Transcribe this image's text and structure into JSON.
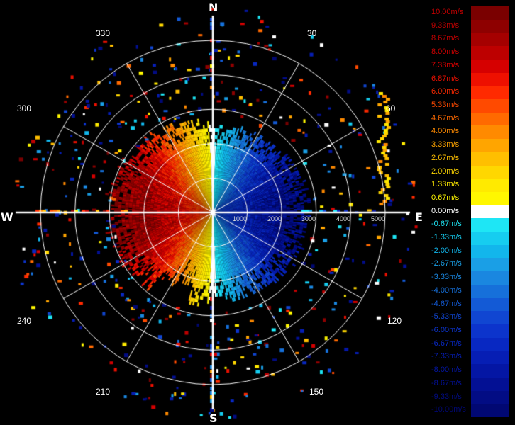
{
  "compass": {
    "north": "N",
    "south": "S",
    "east": "E",
    "west": "W"
  },
  "angle_labels": [
    "30",
    "60",
    "120",
    "150",
    "210",
    "240",
    "300",
    "330"
  ],
  "range_labels": [
    "1000",
    "2000",
    "3000",
    "4000",
    "5000"
  ],
  "legend": {
    "items": [
      {
        "label": "10.00m/s",
        "color": "#7a0000",
        "text_color": "#c00000"
      },
      {
        "label": "9.33m/s",
        "color": "#8e0000",
        "text_color": "#c00000"
      },
      {
        "label": "8.67m/s",
        "color": "#a50000",
        "text_color": "#c80000"
      },
      {
        "label": "8.00m/s",
        "color": "#bd0000",
        "text_color": "#d00000"
      },
      {
        "label": "7.33m/s",
        "color": "#d60000",
        "text_color": "#e00000"
      },
      {
        "label": "6.87m/s",
        "color": "#ee1000",
        "text_color": "#ee1000"
      },
      {
        "label": "6.00m/s",
        "color": "#ff2a00",
        "text_color": "#ff2a00"
      },
      {
        "label": "5.33m/s",
        "color": "#ff4a00",
        "text_color": "#ff4a00"
      },
      {
        "label": "4.67m/s",
        "color": "#ff6a00",
        "text_color": "#ff6a00"
      },
      {
        "label": "4.00m/s",
        "color": "#ff8a00",
        "text_color": "#ff8a00"
      },
      {
        "label": "3.33m/s",
        "color": "#ffa500",
        "text_color": "#ffa500"
      },
      {
        "label": "2.67m/s",
        "color": "#ffbf00",
        "text_color": "#ffbf00"
      },
      {
        "label": "2.00m/s",
        "color": "#ffd700",
        "text_color": "#ffd700"
      },
      {
        "label": "1.33m/s",
        "color": "#ffea00",
        "text_color": "#ffea00"
      },
      {
        "label": "0.67m/s",
        "color": "#fff700",
        "text_color": "#fff700"
      },
      {
        "label": "0.00m/s",
        "color": "#ffffff",
        "text_color": "#ffffff"
      },
      {
        "label": "-0.67m/s",
        "color": "#1ee6f5",
        "text_color": "#1ee6f5"
      },
      {
        "label": "-1.33m/s",
        "color": "#16cdf0",
        "text_color": "#16cdf0"
      },
      {
        "label": "-2.00m/s",
        "color": "#12b6ec",
        "text_color": "#12b6ec"
      },
      {
        "label": "-2.67m/s",
        "color": "#1a9fe6",
        "text_color": "#1a9fe6"
      },
      {
        "label": "-3.33m/s",
        "color": "#1a87e0",
        "text_color": "#1a87e0"
      },
      {
        "label": "-4.00m/s",
        "color": "#1670da",
        "text_color": "#1670da"
      },
      {
        "label": "-4.67m/s",
        "color": "#135ad6",
        "text_color": "#135ad6"
      },
      {
        "label": "-5.33m/s",
        "color": "#1046d2",
        "text_color": "#1046d2"
      },
      {
        "label": "-6.00m/s",
        "color": "#0c34cc",
        "text_color": "#0c34cc"
      },
      {
        "label": "-6.67m/s",
        "color": "#0828c2",
        "text_color": "#0828c2"
      },
      {
        "label": "-7.33m/s",
        "color": "#061eb4",
        "text_color": "#061eb4"
      },
      {
        "label": "-8.00m/s",
        "color": "#0416a4",
        "text_color": "#0416a4"
      },
      {
        "label": "-8.67m/s",
        "color": "#031094",
        "text_color": "#031094"
      },
      {
        "label": "-9.33m/s",
        "color": "#020c84",
        "text_color": "#020c84"
      },
      {
        "label": "-10.00m/s",
        "color": "#010873",
        "text_color": "#010873"
      }
    ]
  }
}
